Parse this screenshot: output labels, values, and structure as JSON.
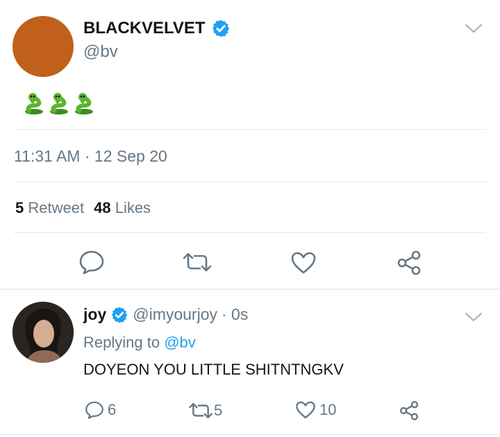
{
  "main_tweet": {
    "display_name": "BLACKVELVET",
    "handle": "@bv",
    "avatar_color": "#c0601a",
    "content_emoji": "🐍🐍🐍",
    "timestamp": "11:31 AM · 12 Sep 20",
    "retweet_count": "5",
    "retweet_label": "Retweet",
    "like_count": "48",
    "like_label": "Likes"
  },
  "reply": {
    "display_name": "joy",
    "handle": "@imyourjoy",
    "time": "· 0s",
    "replying_prefix": "Replying to",
    "replying_to": "@bv",
    "text": "DOYEON YOU LITTLE SHITNTNGKV",
    "reply_count": "6",
    "retweet_count": "5",
    "like_count": "10"
  },
  "colors": {
    "accent": "#1da1f2",
    "muted": "#657786",
    "divider": "#e1e8ed"
  },
  "icons": [
    "verified-badge-icon",
    "chevron-down-icon",
    "reply-icon",
    "retweet-icon",
    "heart-icon",
    "share-icon"
  ]
}
